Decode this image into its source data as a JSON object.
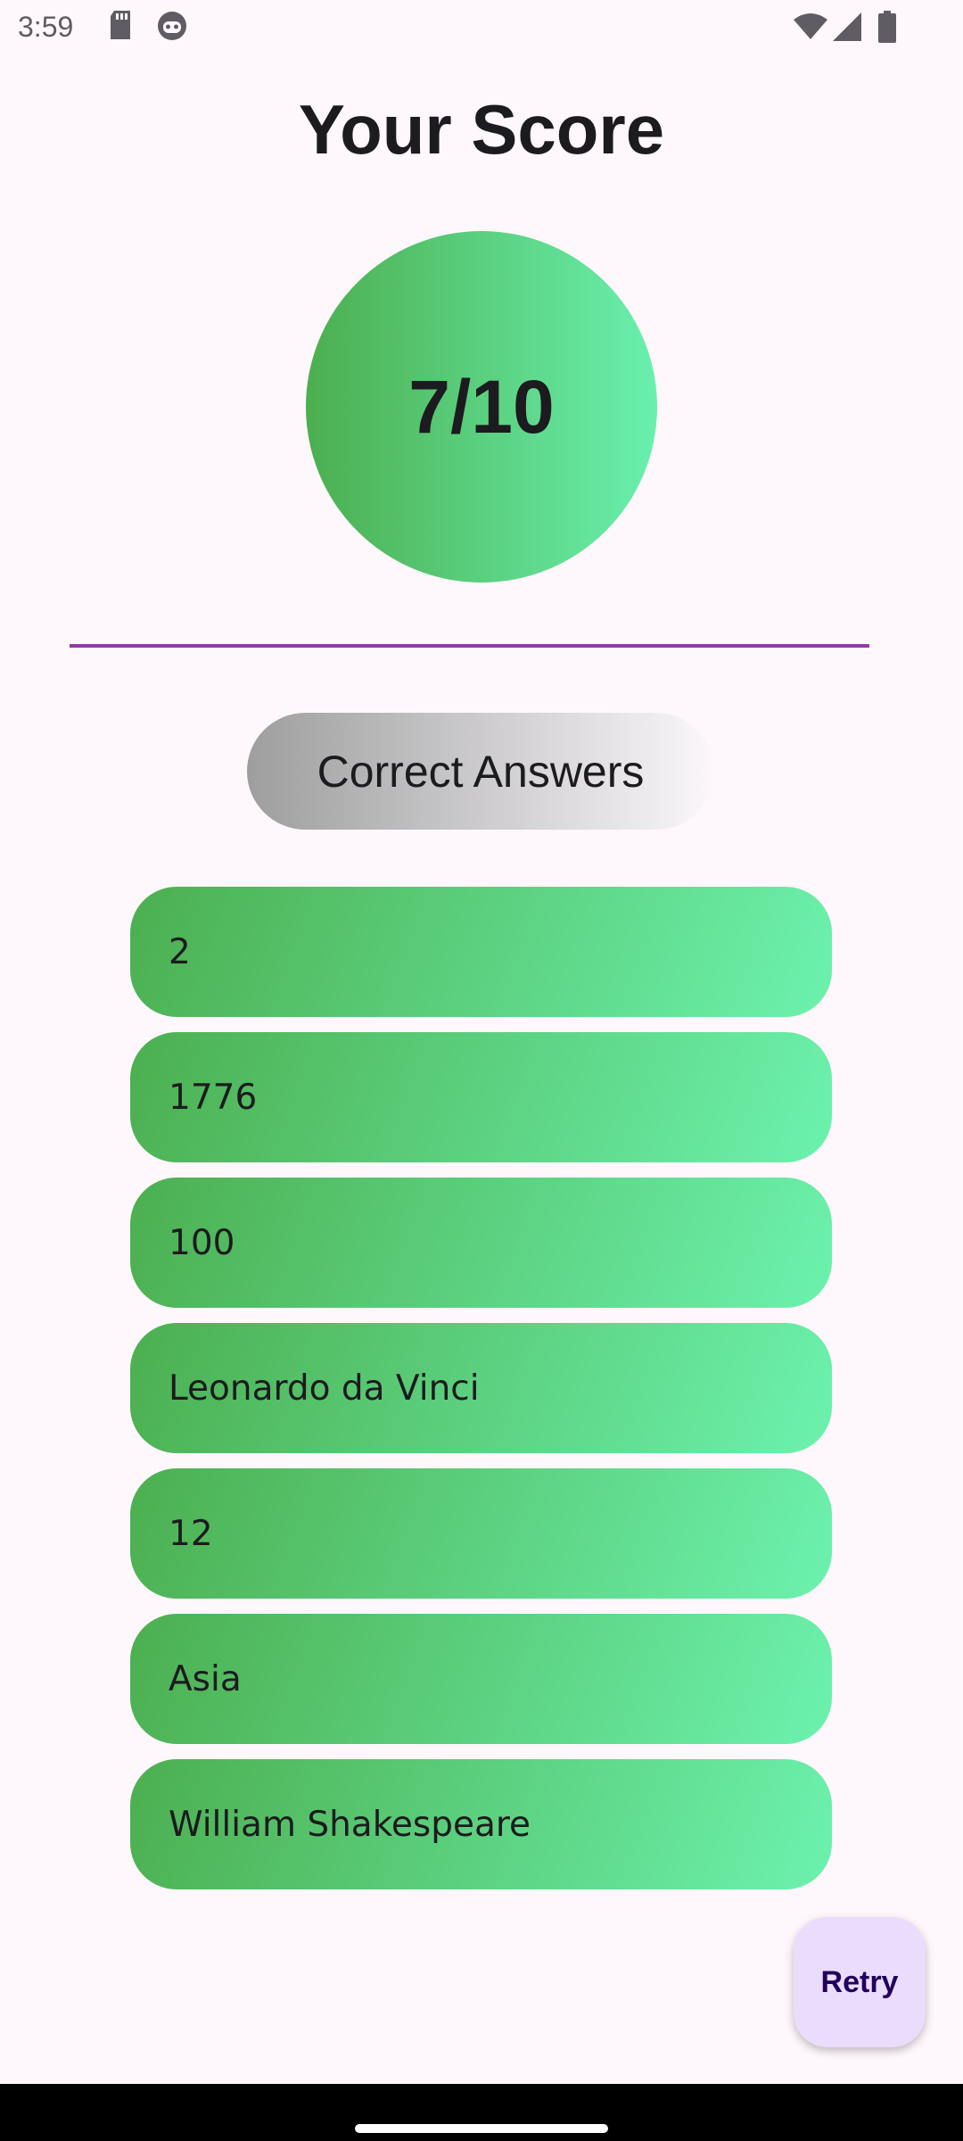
{
  "status_bar": {
    "time": "3:59",
    "icons": [
      "sd-card-icon",
      "robot-icon",
      "wifi-icon",
      "signal-icon",
      "battery-icon"
    ]
  },
  "title": "Your Score",
  "score": "7/10",
  "section_label": "Correct Answers",
  "answers": [
    "2",
    "1776",
    "100",
    "Leonardo da Vinci",
    "12",
    "Asia",
    "William Shakespeare"
  ],
  "retry_label": "Retry",
  "colors": {
    "gradient_start": "#4caf50",
    "gradient_end": "#69f0ae",
    "divider": "#8e3da0",
    "background": "#fef7fb",
    "fab": "#eadcfb",
    "fab_text": "#21005d"
  }
}
